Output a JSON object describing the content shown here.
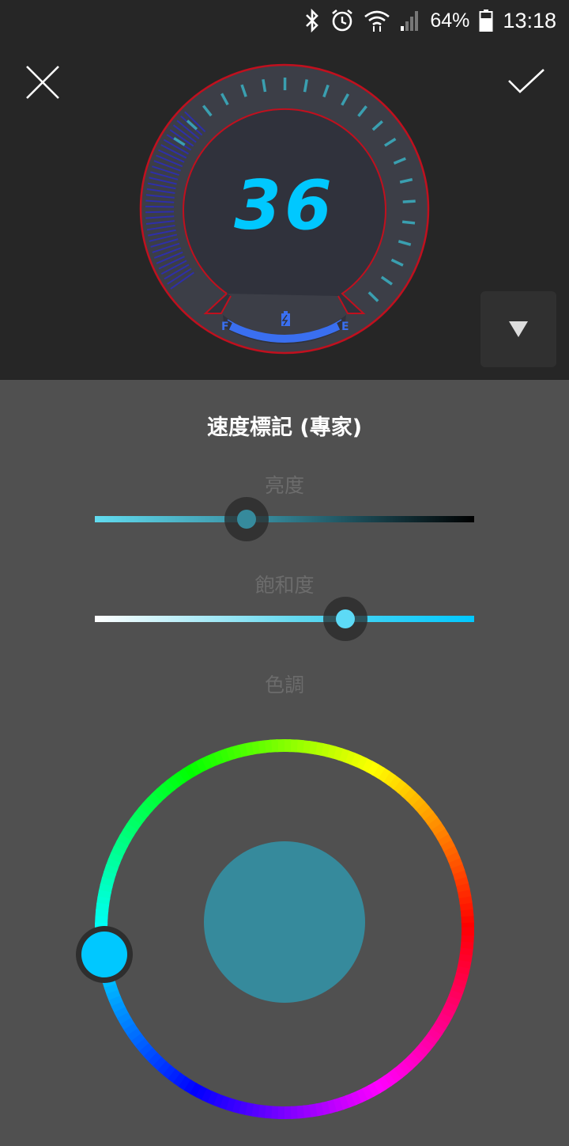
{
  "status_bar": {
    "battery_percent": "64%",
    "time": "13:18",
    "icons": [
      "bluetooth-icon",
      "alarm-icon",
      "wifi-icon",
      "signal-icon",
      "battery-icon"
    ]
  },
  "toolbar": {
    "close_icon": "close-icon",
    "confirm_icon": "check-icon",
    "collapse_icon": "triangle-down-icon"
  },
  "gauge": {
    "speed_value": "36",
    "fuel_full_label": "F",
    "fuel_empty_label": "E",
    "fuel_icon": "battery-charging-icon",
    "colors": {
      "accent": "#00c8ff",
      "outline": "#c0101e",
      "ticks": "#3a9fb0",
      "fill": "#2e2fa8"
    }
  },
  "panel": {
    "title": "速度標記 (專家)",
    "brightness": {
      "label": "亮度",
      "value_fraction": 0.4
    },
    "saturation": {
      "label": "飽和度",
      "value_fraction": 0.66
    },
    "hue": {
      "label": "色調",
      "preview_color": "#368a9c",
      "selected_color": "#00c8ff"
    }
  }
}
